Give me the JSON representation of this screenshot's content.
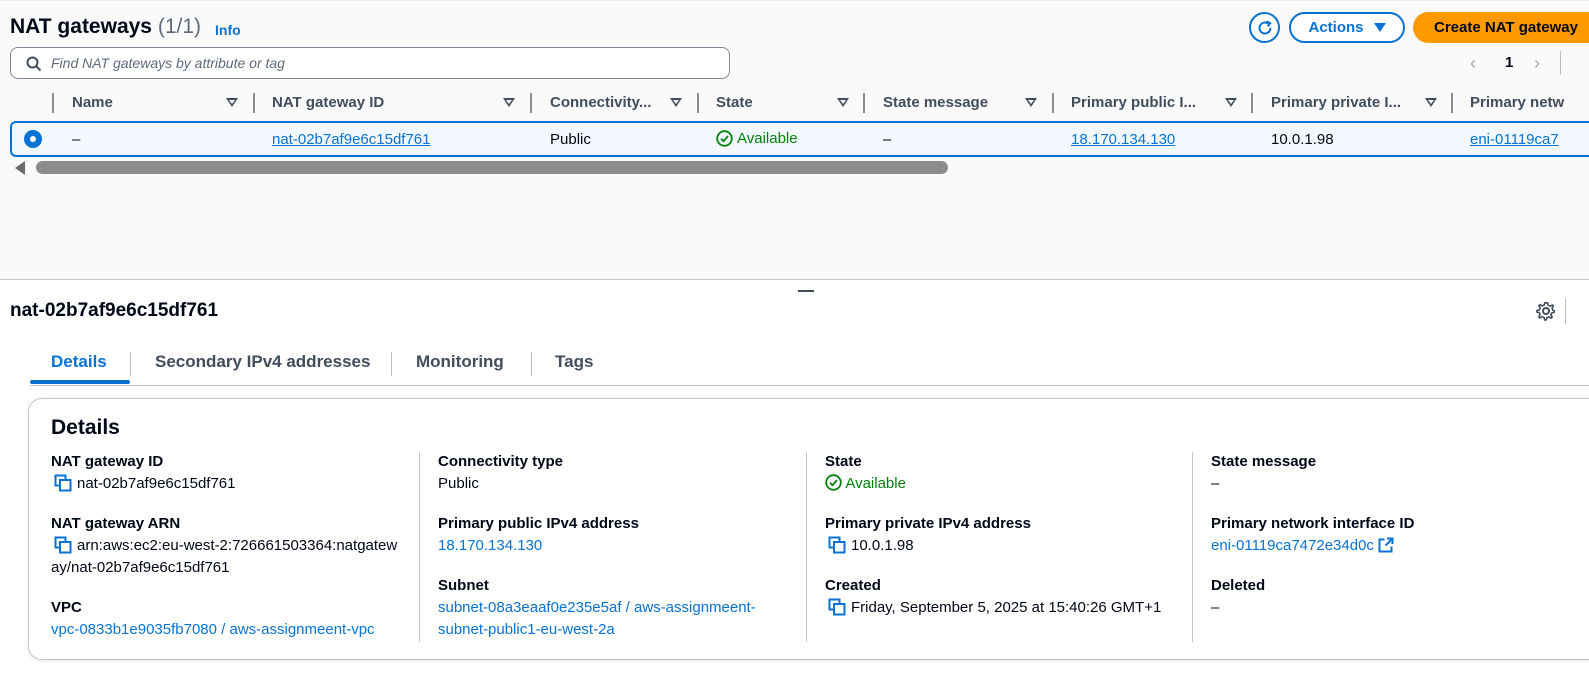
{
  "header": {
    "title": "NAT gateways",
    "count": "(1/1)",
    "info": "Info",
    "actions_label": "Actions",
    "create_label": "Create NAT gateway"
  },
  "search": {
    "placeholder": "Find NAT gateways by attribute or tag"
  },
  "pagination": {
    "current_page": "1"
  },
  "table": {
    "columns": [
      "Name",
      "NAT gateway ID",
      "Connectivity...",
      "State",
      "State message",
      "Primary public I...",
      "Primary private I...",
      "Primary netw"
    ],
    "rows": [
      {
        "name": "–",
        "nat_gateway_id": "nat-02b7af9e6c15df761",
        "connectivity": "Public",
        "state": "Available",
        "state_message": "–",
        "primary_public_ip": "18.170.134.130",
        "primary_private_ip": "10.0.1.98",
        "primary_network": "eni-01119ca7"
      }
    ]
  },
  "detail": {
    "title": "nat-02b7af9e6c15df761",
    "tabs": [
      "Details",
      "Secondary IPv4 addresses",
      "Monitoring",
      "Tags"
    ],
    "active_tab": "Details",
    "card_title": "Details",
    "fields": {
      "nat_gateway_id": {
        "label": "NAT gateway ID",
        "value": "nat-02b7af9e6c15df761"
      },
      "nat_gateway_arn": {
        "label": "NAT gateway ARN",
        "value": "arn:aws:ec2:eu-west-2:726661503364:natgateway/nat-02b7af9e6c15df761"
      },
      "vpc": {
        "label": "VPC",
        "value": "vpc-0833b1e9035fb7080 / aws-assignmeent-vpc"
      },
      "connectivity_type": {
        "label": "Connectivity type",
        "value": "Public"
      },
      "primary_public_ipv4": {
        "label": "Primary public IPv4 address",
        "value": "18.170.134.130"
      },
      "subnet": {
        "label": "Subnet",
        "value": "subnet-08a3eaaf0e235e5af / aws-assignmeent-subnet-public1-eu-west-2a"
      },
      "state": {
        "label": "State",
        "value": "Available"
      },
      "primary_private_ipv4": {
        "label": "Primary private IPv4 address",
        "value": "10.0.1.98"
      },
      "created": {
        "label": "Created",
        "value": "Friday, September 5, 2025 at 15:40:26 GMT+1"
      },
      "state_message": {
        "label": "State message",
        "value": "–"
      },
      "primary_network_interface_id": {
        "label": "Primary network interface ID",
        "value": "eni-01119ca7472e34d0c"
      },
      "deleted": {
        "label": "Deleted",
        "value": "–"
      }
    }
  },
  "colors": {
    "accent": "#0972d3",
    "primary_button": "#ff9900",
    "success": "#037f0c",
    "text": "#000716"
  },
  "icons": [
    "refresh-icon",
    "caret-down-icon",
    "search-icon",
    "chevron-left-icon",
    "chevron-right-icon",
    "sort-icon",
    "status-success-icon",
    "gear-icon",
    "copy-icon",
    "external-link-icon"
  ]
}
